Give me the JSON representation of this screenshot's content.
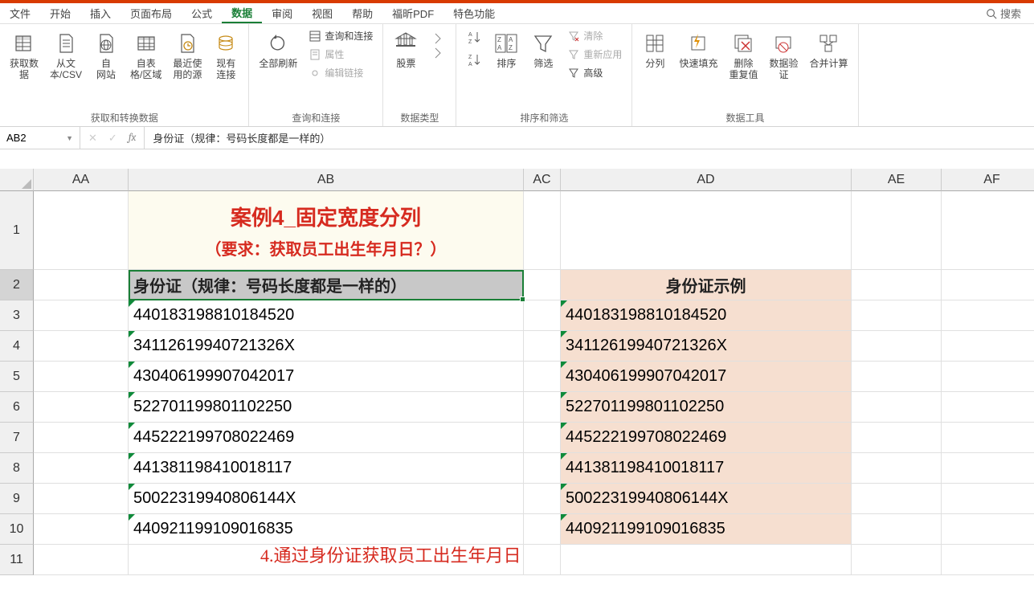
{
  "tabs": [
    "文件",
    "开始",
    "插入",
    "页面布局",
    "公式",
    "数据",
    "审阅",
    "视图",
    "帮助",
    "福昕PDF",
    "特色功能"
  ],
  "active_tab_index": 5,
  "search_label": "搜索",
  "ribbon": {
    "g1": {
      "label": "获取和转换数据",
      "items": [
        "获取数\n据 ",
        "从文\n本/CSV",
        "自\n网站",
        "自表\n格/区域",
        "最近使\n用的源",
        "现有\n连接"
      ]
    },
    "g2": {
      "label": "查询和连接",
      "main": "全部刷新\n",
      "minis": [
        "查询和连接",
        "属性",
        "编辑链接"
      ]
    },
    "g3": {
      "label": "数据类型",
      "items": [
        "股票"
      ]
    },
    "g4": {
      "label": "排序和筛选",
      "sortBtns": [
        "A\nZ",
        "Z\nA"
      ],
      "items": [
        "排序",
        "筛选"
      ],
      "minis": [
        "清除",
        "重新应用",
        "高级"
      ]
    },
    "g5": {
      "label": "数据工具",
      "items": [
        "分列",
        "快速填充",
        "删除\n重复值",
        "数据验\n证 ",
        "合并计算"
      ]
    }
  },
  "namebox": "AB2",
  "formula": "身份证（规律：号码长度都是一样的）",
  "columns": [
    "AA",
    "AB",
    "AC",
    "AD",
    "AE",
    "AF"
  ],
  "row_labels": [
    "1",
    "2",
    "3",
    "4",
    "5",
    "6",
    "7",
    "8",
    "9",
    "10",
    "11"
  ],
  "title": {
    "t1": "案例4_固定宽度分列",
    "t2": "（要求：获取员工出生年月日？）"
  },
  "headers": {
    "ab": "身份证（规律：号码长度都是一样的）",
    "ad": "身份证示例"
  },
  "ids": [
    "440183198810184520",
    "34112619940721326X",
    "430406199907042017",
    "522701199801102250",
    "445222199708022469",
    "441381198410018117",
    "50022319940806144X",
    "440921199109016835"
  ],
  "caption": "4.通过身份证获取员工出生年月日"
}
